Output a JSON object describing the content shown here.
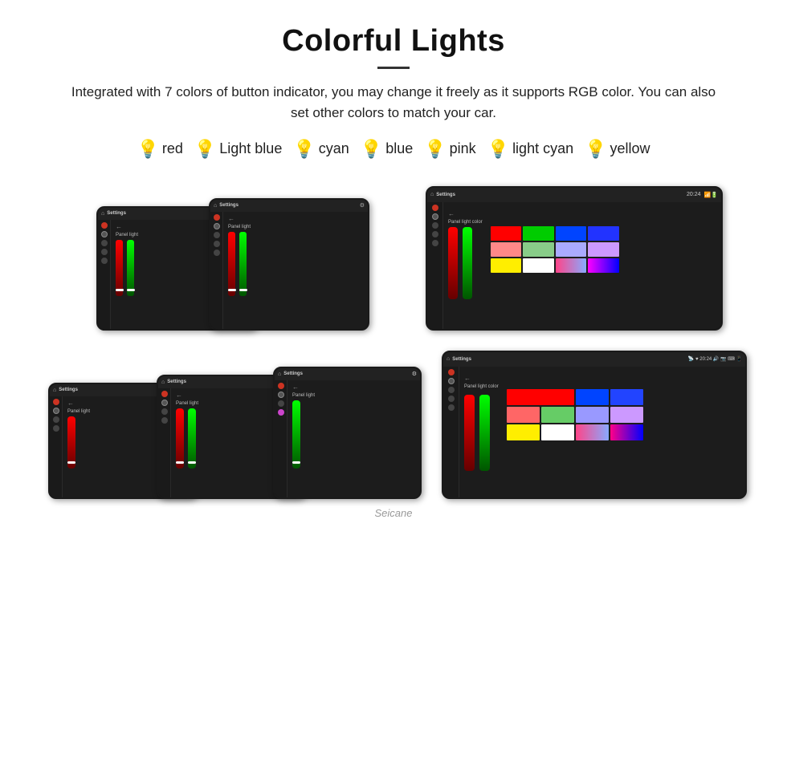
{
  "header": {
    "title": "Colorful Lights",
    "description": "Integrated with 7 colors of button indicator, you may change it freely as it supports RGB color. You can also set other colors to match your car."
  },
  "colors": [
    {
      "name": "red",
      "emoji": "🔴",
      "hex": "#ff3322"
    },
    {
      "name": "Light blue",
      "emoji": "💧",
      "hex": "#aaddff"
    },
    {
      "name": "cyan",
      "emoji": "💠",
      "hex": "#00ffee"
    },
    {
      "name": "blue",
      "emoji": "🔵",
      "hex": "#3355ff"
    },
    {
      "name": "pink",
      "emoji": "🔮",
      "hex": "#ff44cc"
    },
    {
      "name": "light cyan",
      "emoji": "💡",
      "hex": "#aaffee"
    },
    {
      "name": "yellow",
      "emoji": "💛",
      "hex": "#ffee00"
    }
  ],
  "row1": {
    "screens": [
      {
        "label": "Panel light",
        "hasRedGreenSlider": true
      },
      {
        "label": "Panel light",
        "hasRedGreenSlider": true
      },
      {
        "label": "Panel light color",
        "hasColorGrid": true
      }
    ]
  },
  "row2": {
    "screens": [
      {
        "label": "Panel light",
        "hasRedSlider": true
      },
      {
        "label": "Panel light",
        "hasRedGreenSlider": true
      },
      {
        "label": "Panel light",
        "hasGreenSlider": true
      },
      {
        "label": "Panel light color",
        "hasColorGrid": true
      }
    ]
  },
  "watermark": "Seicane",
  "colorGrid1": [
    "#ff0000",
    "#00cc00",
    "#0000ff",
    "#0000ff",
    "#ff6666",
    "#66cc66",
    "#9999ff",
    "#cc99ff",
    "#ffee00",
    "#ffffff",
    "#ff44cc",
    "#ff44ff"
  ],
  "colorGrid2": [
    "#ff0000",
    "#00cc00",
    "#0000ff",
    "#0000ff",
    "#ff6666",
    "#66cc66",
    "#9999ff",
    "#cc99ff",
    "#ffee00",
    "#ffffff",
    "#ff44cc",
    "#ffaaff"
  ]
}
